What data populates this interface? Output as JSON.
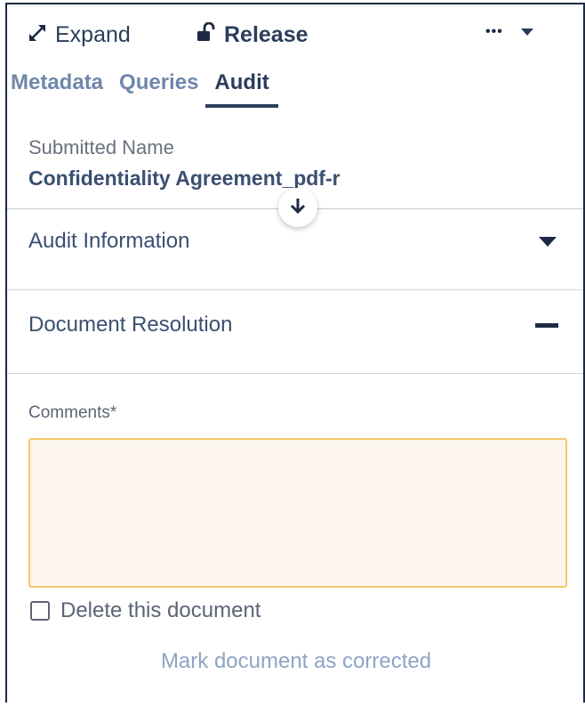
{
  "toolbar": {
    "expand_label": "Expand",
    "release_label": "Release",
    "more_label": "•••"
  },
  "tabs": [
    {
      "label": "Metadata",
      "active": false
    },
    {
      "label": "Queries",
      "active": false
    },
    {
      "label": "Audit",
      "active": true
    }
  ],
  "submitted": {
    "label": "Submitted Name",
    "value": "Confidentiality Agreement_pdf-r"
  },
  "sections": [
    {
      "title": "Audit Information",
      "state": "collapsed"
    },
    {
      "title": "Document Resolution",
      "state": "expanded"
    }
  ],
  "resolution": {
    "comments_label": "Comments*",
    "comments_value": "",
    "delete_label": "Delete this document",
    "delete_checked": false,
    "mark_corrected_label": "Mark document as corrected"
  },
  "colors": {
    "primary": "#2b3d5c",
    "tab_inactive": "#6f87aa",
    "link": "#8ea4c6",
    "required_border": "#f5c56a",
    "required_fill": "#fdf6ee"
  }
}
